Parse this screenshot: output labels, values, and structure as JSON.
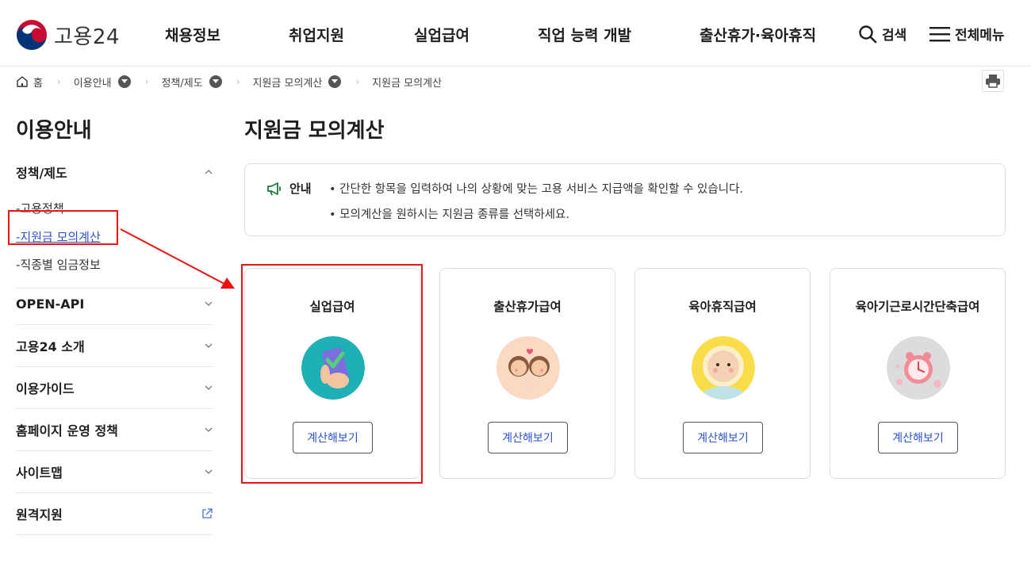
{
  "header": {
    "logo_text": "고용24",
    "nav": [
      "채용정보",
      "취업지원",
      "실업급여",
      "직업 능력 개발",
      "출산휴가·육아휴직"
    ],
    "search_label": "검색",
    "menu_label": "전체메뉴"
  },
  "breadcrumb": {
    "home": "홈",
    "items": [
      "이용안내",
      "정책/제도",
      "지원금 모의계산",
      "지원금 모의계산"
    ]
  },
  "sidebar": {
    "title": "이용안내",
    "section_policy": "정책/제도",
    "sub_items": [
      "-고용정책",
      "-지원금 모의계산",
      "-직종별 임금정보"
    ],
    "sections": [
      "OPEN-API",
      "고용24 소개",
      "이용가이드",
      "홈페이지 운영 정책",
      "사이트맵",
      "원격지원"
    ]
  },
  "main": {
    "title": "지원금 모의계산",
    "notice": {
      "label": "안내",
      "lines": [
        "• 간단한 항목을 입력하여 나의 상황에 맞는 고용 서비스 지급액을 확인할 수 있습니다.",
        "• 모의계산을 원하시는 지원금 종류를 선택하세요."
      ]
    },
    "cards": [
      {
        "title": "실업급여",
        "button": "계산해보기",
        "icon": "phone-check-icon"
      },
      {
        "title": "출산휴가급여",
        "button": "계산해보기",
        "icon": "family-icon"
      },
      {
        "title": "육아휴직급여",
        "button": "계산해보기",
        "icon": "baby-icon"
      },
      {
        "title": "육아기근로시간단축급여",
        "button": "계산해보기",
        "icon": "clock-icon"
      }
    ]
  },
  "colors": {
    "accent_blue": "#2b53c9",
    "highlight_red": "#e11111",
    "notice_green": "#1a7a3c"
  }
}
